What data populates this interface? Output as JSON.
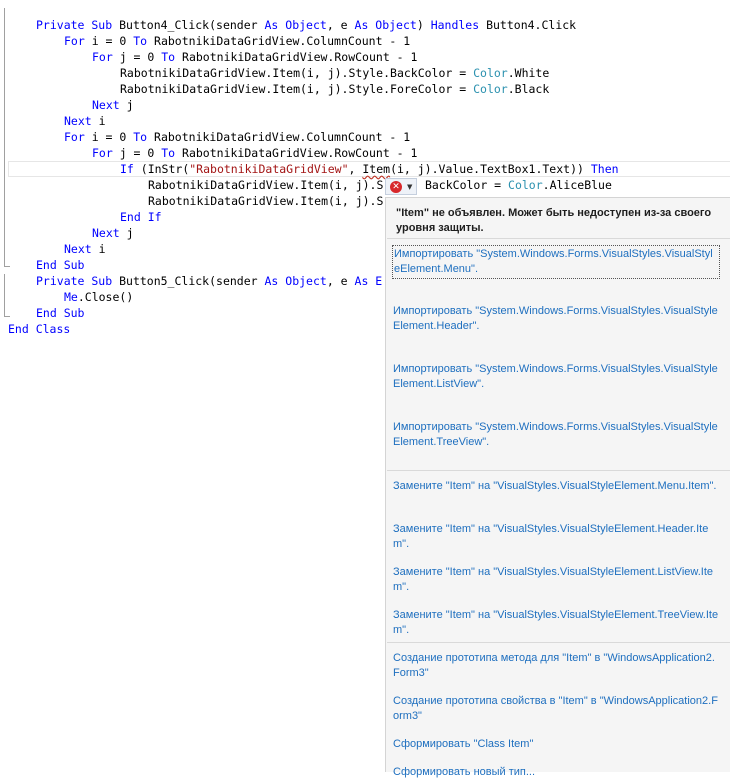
{
  "code": [
    {
      "indent": 1,
      "parts": [
        [
          "kw",
          "Private Sub "
        ],
        [
          "",
          ""
        ],
        [
          "",
          "Button4_Click(sender "
        ],
        [
          "kw",
          "As Object"
        ],
        [
          "",
          ", e "
        ],
        [
          "kw",
          "As Object"
        ],
        [
          "",
          ") "
        ],
        [
          "kw",
          "Handles "
        ],
        [
          "",
          "Button4.Click"
        ]
      ]
    },
    {
      "indent": 2,
      "parts": [
        [
          "kw",
          "For "
        ],
        [
          "",
          "i = 0 "
        ],
        [
          "kw",
          "To "
        ],
        [
          "",
          "RabotnikiDataGridView.ColumnCount - 1"
        ]
      ]
    },
    {
      "indent": 3,
      "parts": [
        [
          "kw",
          "For "
        ],
        [
          "",
          "j = 0 "
        ],
        [
          "kw",
          "To "
        ],
        [
          "",
          "RabotnikiDataGridView.RowCount - 1"
        ]
      ]
    },
    {
      "indent": 4,
      "parts": [
        [
          "",
          "RabotnikiDataGridView.Item(i, j).Style.BackColor = "
        ],
        [
          "ty",
          "Color"
        ],
        [
          "",
          ".White"
        ]
      ]
    },
    {
      "indent": 4,
      "parts": [
        [
          "",
          "RabotnikiDataGridView.Item(i, j).Style.ForeColor = "
        ],
        [
          "ty",
          "Color"
        ],
        [
          "",
          ".Black"
        ]
      ]
    },
    {
      "indent": 3,
      "parts": [
        [
          "kw",
          "Next "
        ],
        [
          "",
          "j"
        ]
      ]
    },
    {
      "indent": 2,
      "parts": [
        [
          "kw",
          "Next "
        ],
        [
          "",
          "i"
        ]
      ]
    },
    {
      "indent": 2,
      "parts": [
        [
          "kw",
          "For "
        ],
        [
          "",
          "i = 0 "
        ],
        [
          "kw",
          "To "
        ],
        [
          "",
          "RabotnikiDataGridView.ColumnCount - 1"
        ]
      ]
    },
    {
      "indent": 3,
      "parts": [
        [
          "kw",
          "For "
        ],
        [
          "",
          "j = 0 "
        ],
        [
          "kw",
          "To "
        ],
        [
          "",
          "RabotnikiDataGridView.RowCount - 1"
        ]
      ]
    },
    {
      "indent": 4,
      "parts": [
        [
          "kw",
          "If "
        ],
        [
          "",
          "(InStr("
        ],
        [
          "st",
          "\"RabotnikiDataGridView\""
        ],
        [
          "",
          ", "
        ],
        [
          "err",
          "Item"
        ],
        [
          "",
          "(i, j).Value.TextBox1.Text)) "
        ],
        [
          "kw",
          "Then"
        ]
      ]
    },
    {
      "indent": 5,
      "parts": [
        [
          "",
          "RabotnikiDataGridView.Item(i, j).S"
        ],
        [
          "",
          "      BackColor = "
        ],
        [
          "ty",
          "Color"
        ],
        [
          "",
          ".AliceBlue"
        ]
      ]
    },
    {
      "indent": 5,
      "parts": [
        [
          "",
          "RabotnikiDataGridView.Item(i, j).S"
        ]
      ]
    },
    {
      "indent": 4,
      "parts": [
        [
          "kw",
          "End If"
        ]
      ]
    },
    {
      "indent": 3,
      "parts": [
        [
          "kw",
          "Next "
        ],
        [
          "",
          "j"
        ]
      ]
    },
    {
      "indent": 2,
      "parts": [
        [
          "kw",
          "Next "
        ],
        [
          "",
          "i"
        ]
      ]
    },
    {
      "indent": 1,
      "parts": [
        [
          "kw",
          "End Sub"
        ]
      ]
    },
    {
      "indent": 1,
      "parts": [
        [
          "kw",
          "Private Sub "
        ],
        [
          "",
          "Button5_Click(sender "
        ],
        [
          "kw",
          "As Object"
        ],
        [
          "",
          ", e "
        ],
        [
          "kw",
          "As E"
        ]
      ]
    },
    {
      "indent": 2,
      "parts": [
        [
          "kw",
          "Me"
        ],
        [
          "",
          ".Close()"
        ]
      ]
    },
    {
      "indent": 1,
      "parts": [
        [
          "kw",
          "End Sub"
        ]
      ]
    },
    {
      "indent": 0,
      "parts": [
        [
          "kw",
          "End Class"
        ]
      ]
    }
  ],
  "smart_tag": {
    "error_icon": "error-x-icon",
    "arrow_icon": "chevron-down-icon",
    "error_glyph": "✕",
    "arrow_glyph": "▼"
  },
  "popup": {
    "error_message": "\"Item\" не объявлен. Может быть недоступен из-за своего уровня защиты.",
    "import_fixes": [
      "Импортировать \"System.Windows.Forms.VisualStyles.VisualStyleElement.Menu\".",
      "Импортировать \"System.Windows.Forms.VisualStyles.VisualStyleElement.Header\".",
      "Импортировать \"System.Windows.Forms.VisualStyles.VisualStyleElement.ListView\".",
      "Импортировать \"System.Windows.Forms.VisualStyles.VisualStyleElement.TreeView\"."
    ],
    "replace_fixes": [
      "Замените \"Item\" на \"VisualStyles.VisualStyleElement.Menu.Item\".",
      "Замените \"Item\" на \"VisualStyles.VisualStyleElement.Header.Item\".",
      "Замените \"Item\" на \"VisualStyles.VisualStyleElement.ListView.Item\".",
      "Замените \"Item\" на \"VisualStyles.VisualStyleElement.TreeView.Item\"."
    ],
    "generate_fixes": [
      "Создание прототипа метода для \"Item\" в \"WindowsApplication2.Form3\"",
      "Создание прототипа свойства в \"Item\" в \"WindowsApplication2.Form3\"",
      "Сформировать \"Class Item\"",
      "Сформировать новый тип..."
    ]
  },
  "colors": {
    "keyword": "#0000ff",
    "type": "#2b91af",
    "string": "#a31515",
    "link": "#1e6fbf",
    "error": "#d7272a"
  }
}
